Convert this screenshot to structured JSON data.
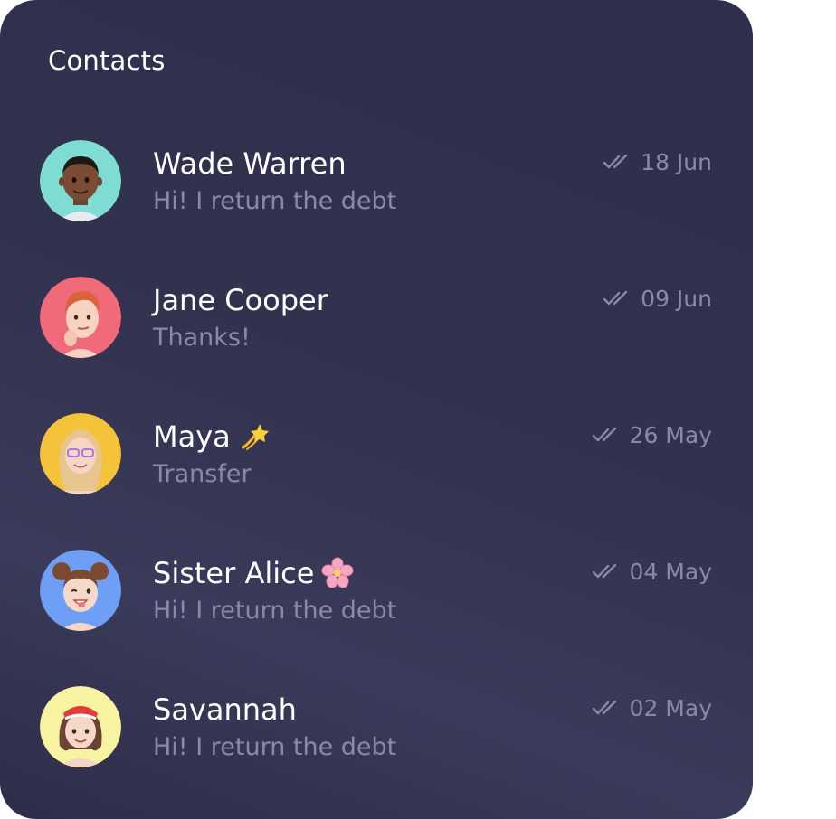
{
  "header": {
    "title": "Contacts"
  },
  "contacts": [
    {
      "name": "Wade Warren",
      "message": "Hi! I return the debt",
      "date": "18 Jun",
      "avatar_bg": "#7fdcd3",
      "status_icon": "double-check-icon"
    },
    {
      "name": "Jane Cooper",
      "message": "Thanks!",
      "date": "09 Jun",
      "avatar_bg": "#f06a7a",
      "status_icon": "double-check-icon"
    },
    {
      "name": "Maya",
      "name_emoji": "dizzy-star-icon",
      "message": "Transfer",
      "date": "26 May",
      "avatar_bg": "#f5c33a",
      "status_icon": "double-check-icon"
    },
    {
      "name": "Sister Alice",
      "name_emoji": "cherry-blossom-icon",
      "message": "Hi! I return the debt",
      "date": "04 May",
      "avatar_bg": "#6e9ef5",
      "status_icon": "double-check-icon"
    },
    {
      "name": "Savannah",
      "message": "Hi! I return the debt",
      "date": "02 May",
      "avatar_bg": "#f7f3a0",
      "status_icon": "double-check-icon"
    }
  ],
  "colors": {
    "panel_bg": "#32324f",
    "name_text": "#ffffff",
    "secondary_text": "#8b8aa6"
  }
}
